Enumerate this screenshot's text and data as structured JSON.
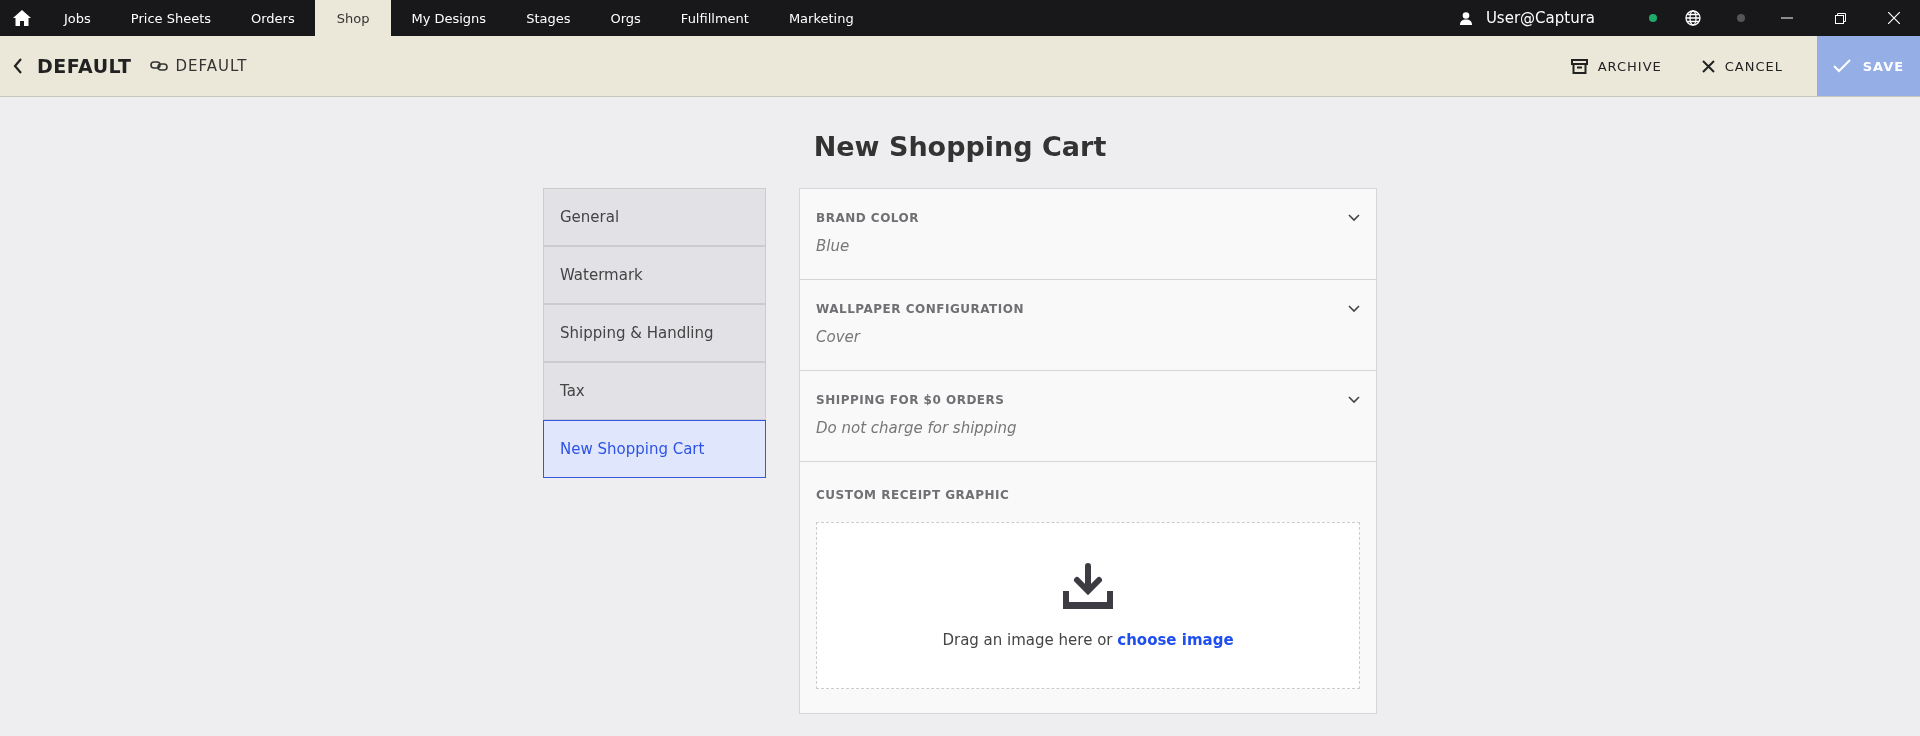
{
  "nav": {
    "tabs": [
      {
        "label": "Jobs",
        "selected": false
      },
      {
        "label": "Price Sheets",
        "selected": false
      },
      {
        "label": "Orders",
        "selected": false
      },
      {
        "label": "Shop",
        "selected": true
      },
      {
        "label": "My Designs",
        "selected": false
      },
      {
        "label": "Stages",
        "selected": false
      },
      {
        "label": "Orgs",
        "selected": false
      },
      {
        "label": "Fulfillment",
        "selected": false
      },
      {
        "label": "Marketing",
        "selected": false
      }
    ],
    "user": "User@Captura"
  },
  "header": {
    "title": "DEFAULT",
    "link_label": "DEFAULT",
    "actions": [
      {
        "kind": "archive",
        "label": "ARCHIVE"
      },
      {
        "kind": "cancel",
        "label": "CANCEL"
      }
    ],
    "save": {
      "label": "SAVE",
      "disabled": true
    }
  },
  "page_title": "New Shopping Cart",
  "sidebar": {
    "items": [
      {
        "label": "General",
        "selected": false
      },
      {
        "label": "Watermark",
        "selected": false
      },
      {
        "label": "Shipping & Handling",
        "selected": false
      },
      {
        "label": "Tax",
        "selected": false
      },
      {
        "label": "New Shopping Cart",
        "selected": true
      }
    ]
  },
  "settings": [
    {
      "kind": "select",
      "label": "BRAND COLOR",
      "value": "Blue"
    },
    {
      "kind": "select",
      "label": "WALLPAPER CONFIGURATION",
      "value": "Cover"
    },
    {
      "kind": "select",
      "label": "SHIPPING FOR $0 ORDERS",
      "value": "Do not charge for shipping"
    },
    {
      "kind": "upload",
      "label": "CUSTOM RECEIPT GRAPHIC",
      "prompt": "Drag an image here or ",
      "link": "choose image"
    }
  ]
}
